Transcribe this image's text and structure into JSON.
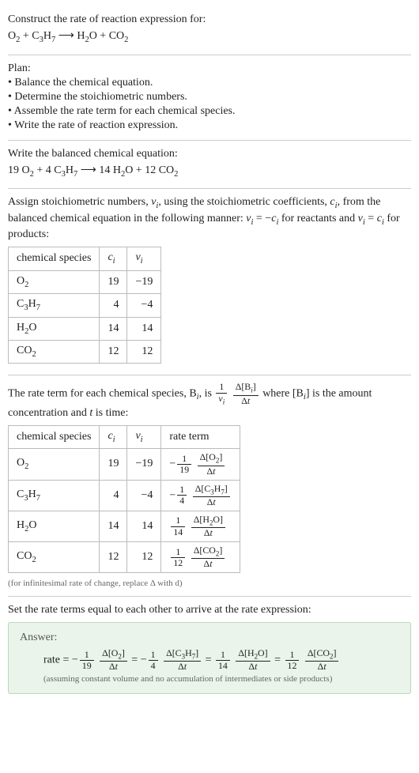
{
  "header": {
    "prompt": "Construct the rate of reaction expression for:",
    "equation_lhs1": "O",
    "equation_lhs1_sub": "2",
    "equation_plus1": " + C",
    "equation_c3h7_3": "3",
    "equation_c3h7_H": "H",
    "equation_c3h7_7": "7",
    "arrow": " ⟶ ",
    "equation_rhs1": "H",
    "equation_rhs1_sub": "2",
    "equation_rhs1_O": "O + CO",
    "equation_rhs2_sub": "2"
  },
  "plan": {
    "title": "Plan:",
    "item1": "• Balance the chemical equation.",
    "item2": "• Determine the stoichiometric numbers.",
    "item3": "• Assemble the rate term for each chemical species.",
    "item4": "• Write the rate of reaction expression."
  },
  "balanced": {
    "title": "Write the balanced chemical equation:",
    "c19": "19 O",
    "sub2a": "2",
    "plus4": " + 4 C",
    "sub3": "3",
    "H": "H",
    "sub7": "7",
    "arrow": " ⟶ ",
    "c14": "14 H",
    "sub2b": "2",
    "Oplus": "O + 12 CO",
    "sub2c": "2"
  },
  "assign": {
    "text1": "Assign stoichiometric numbers, ",
    "nu": "ν",
    "i1": "i",
    "text2": ", using the stoichiometric coefficients, ",
    "c": "c",
    "i2": "i",
    "text3": ", from the balanced chemical equation in the following manner: ",
    "nu2": "ν",
    "i3": "i",
    "eq": " = −",
    "c2": "c",
    "i4": "i",
    "text4": " for reactants and ",
    "nu3": "ν",
    "i5": "i",
    "eq2": " = ",
    "c3": "c",
    "i6": "i",
    "text5": " for products:"
  },
  "table1": {
    "h1": "chemical species",
    "h2": "c",
    "h2sub": "i",
    "h3": "ν",
    "h3sub": "i",
    "rows": [
      {
        "sp_a": "O",
        "sp_sub": "2",
        "c": "19",
        "nu": "−19"
      },
      {
        "sp_a": "C",
        "sp_sub": "3",
        "sp_b": "H",
        "sp_sub2": "7",
        "c": "4",
        "nu": "−4"
      },
      {
        "sp_a": "H",
        "sp_sub": "2",
        "sp_b": "O",
        "c": "14",
        "nu": "14"
      },
      {
        "sp_a": "CO",
        "sp_sub": "2",
        "c": "12",
        "nu": "12"
      }
    ]
  },
  "rateterm_intro": {
    "text1": "The rate term for each chemical species, B",
    "i1": "i",
    "text2": ", is ",
    "one": "1",
    "nu": "ν",
    "nui": "i",
    "deltaB": "Δ[B",
    "Bi": "i",
    "closeB": "]",
    "deltat": "Δt",
    "text3": " where [B",
    "i2": "i",
    "text4": "] is the amount concentration and ",
    "t": "t",
    "text5": " is time:"
  },
  "table2": {
    "h1": "chemical species",
    "h2": "c",
    "h2sub": "i",
    "h3": "ν",
    "h3sub": "i",
    "h4": "rate term",
    "rows": [
      {
        "sp_a": "O",
        "sp_sub": "2",
        "sp_b": "",
        "sp_sub2": "",
        "c": "19",
        "nu": "−19",
        "sign": "−",
        "rn": "1",
        "rd": "19",
        "dnum": "Δ[O",
        "dnum_sub": "2",
        "dnum_close": "]",
        "dden": "Δt"
      },
      {
        "sp_a": "C",
        "sp_sub": "3",
        "sp_b": "H",
        "sp_sub2": "7",
        "c": "4",
        "nu": "−4",
        "sign": "−",
        "rn": "1",
        "rd": "4",
        "dnum": "Δ[C",
        "dnum_sub": "3",
        "dnum_mid": "H",
        "dnum_sub2": "7",
        "dnum_close": "]",
        "dden": "Δt"
      },
      {
        "sp_a": "H",
        "sp_sub": "2",
        "sp_b": "O",
        "sp_sub2": "",
        "c": "14",
        "nu": "14",
        "sign": "",
        "rn": "1",
        "rd": "14",
        "dnum": "Δ[H",
        "dnum_sub": "2",
        "dnum_mid": "O",
        "dnum_close": "]",
        "dden": "Δt"
      },
      {
        "sp_a": "CO",
        "sp_sub": "2",
        "sp_b": "",
        "sp_sub2": "",
        "c": "12",
        "nu": "12",
        "sign": "",
        "rn": "1",
        "rd": "12",
        "dnum": "Δ[CO",
        "dnum_sub": "2",
        "dnum_close": "]",
        "dden": "Δt"
      }
    ]
  },
  "note_infinitesimal": "(for infinitesimal rate of change, replace Δ with d)",
  "set_equal": "Set the rate terms equal to each other to arrive at the rate expression:",
  "answer": {
    "label": "Answer:",
    "rate": "rate = ",
    "t1": {
      "sign": "−",
      "rn": "1",
      "rd": "19",
      "num": "Δ[O",
      "sub": "2",
      "close": "]",
      "den": "Δt"
    },
    "eq1": " = ",
    "t2": {
      "sign": "−",
      "rn": "1",
      "rd": "4",
      "num": "Δ[C",
      "sub": "3",
      "mid": "H",
      "sub2": "7",
      "close": "]",
      "den": "Δt"
    },
    "eq2": " = ",
    "t3": {
      "sign": "",
      "rn": "1",
      "rd": "14",
      "num": "Δ[H",
      "sub": "2",
      "mid": "O",
      "close": "]",
      "den": "Δt"
    },
    "eq3": " = ",
    "t4": {
      "sign": "",
      "rn": "1",
      "rd": "12",
      "num": "Δ[CO",
      "sub": "2",
      "close": "]",
      "den": "Δt"
    },
    "assume": "(assuming constant volume and no accumulation of intermediates or side products)"
  }
}
